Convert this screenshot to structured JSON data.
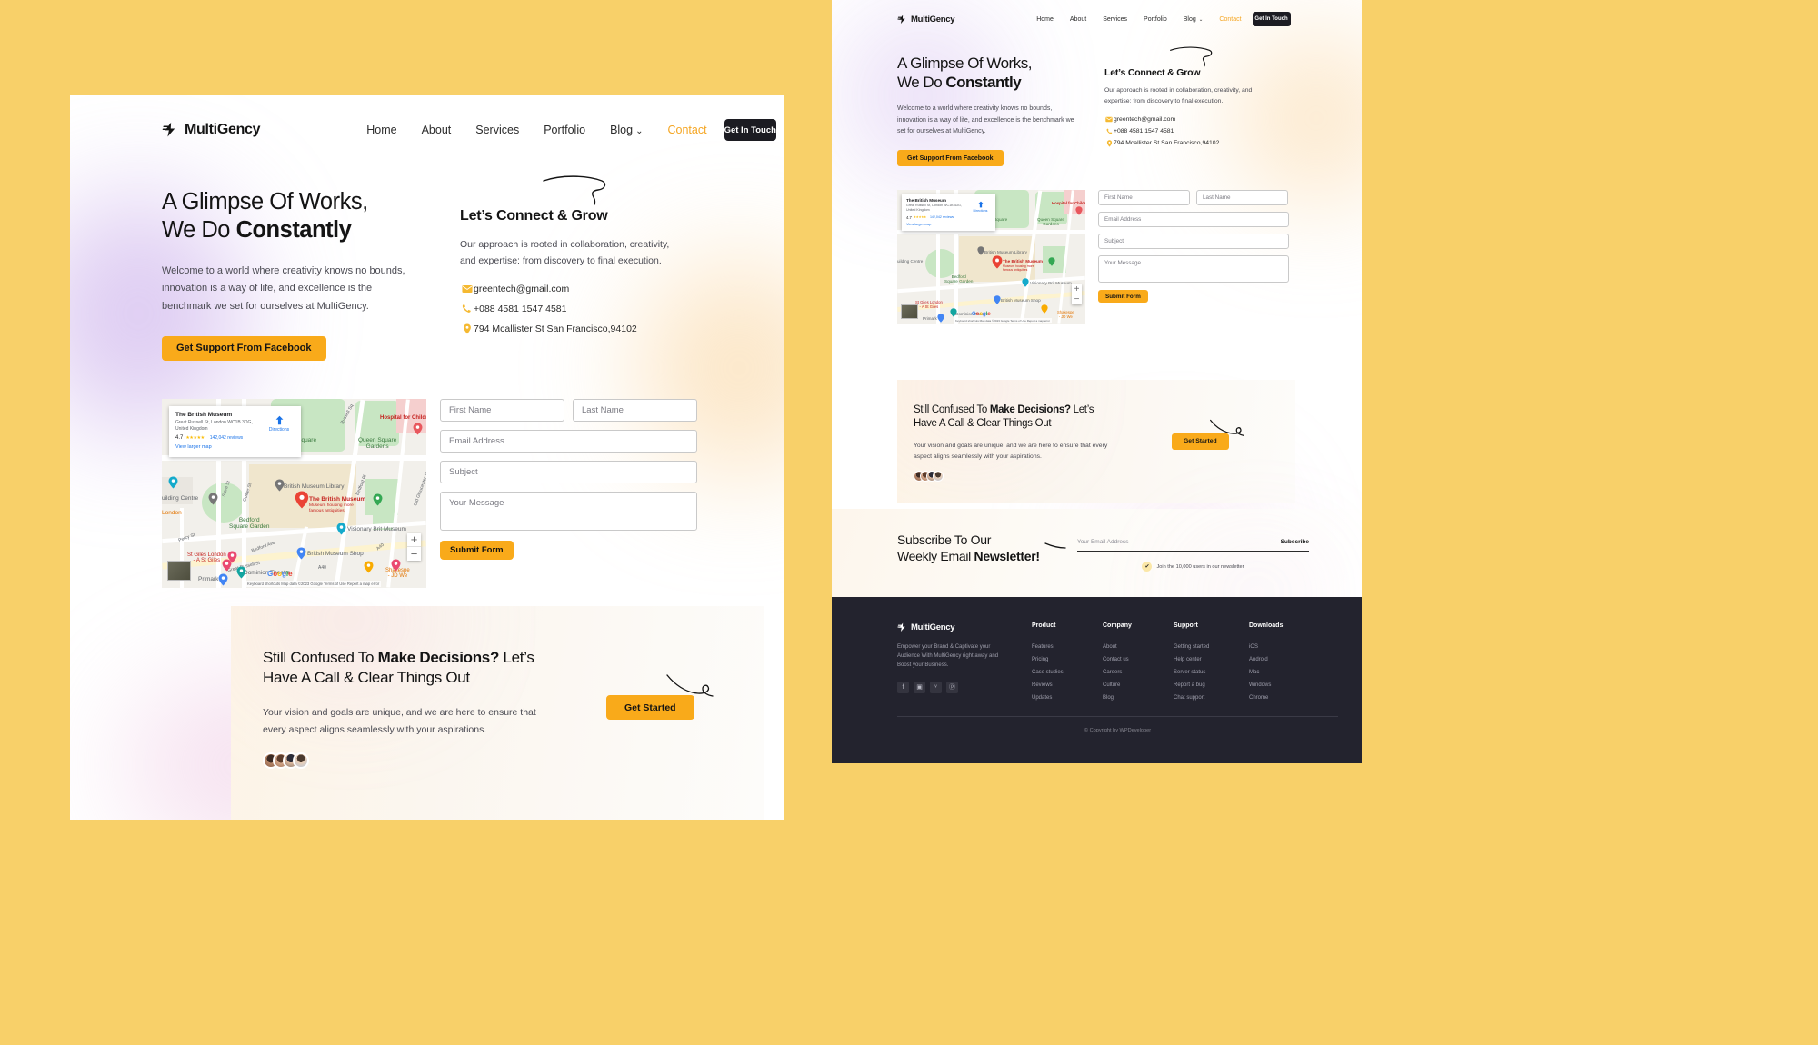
{
  "theme": {
    "bg_yellow": "#F8D069",
    "accent_yellow": "#F9AA1A",
    "nav_active": "#F5A623",
    "dark": "#1c1c22",
    "footer_bg": "#23232e"
  },
  "nav": {
    "brand": "MultiGency",
    "brand_icon": "bolt-icon",
    "links": [
      {
        "label": "Home",
        "active": false,
        "dropdown": false
      },
      {
        "label": "About",
        "active": false,
        "dropdown": false
      },
      {
        "label": "Services",
        "active": false,
        "dropdown": false
      },
      {
        "label": "Portfolio",
        "active": false,
        "dropdown": false
      },
      {
        "label": "Blog",
        "active": false,
        "dropdown": true
      },
      {
        "label": "Contact",
        "active": true,
        "dropdown": false
      }
    ],
    "cta": "Get In Touch",
    "chevron": "⌄"
  },
  "hero": {
    "title_line1": "A Glimpse Of Works,",
    "title_line2_normal": "We Do ",
    "title_line2_bold": "Constantly",
    "paragraph": "Welcome to a world where creativity knows no bounds, innovation is a way of life, and excellence is the benchmark we set for ourselves at MultiGency.",
    "cta": "Get Support From Facebook"
  },
  "connect": {
    "title": "Let’s Connect & Grow",
    "paragraph": "Our approach is rooted in collaboration, creativity, and expertise: from discovery to final execution.",
    "items": [
      {
        "icon": "mail-icon",
        "text": "greentech@gmail.com"
      },
      {
        "icon": "phone-icon",
        "text": "+088 4581 1547 4581"
      },
      {
        "icon": "location-pin-icon",
        "text": "794 Mcallister St San Francisco,94102"
      }
    ]
  },
  "map": {
    "info_card": {
      "title": "The British Museum",
      "address_line1": "Great Russell St, London WC1B 3DG,",
      "address_line2": "United Kingdom",
      "rating": "4.7",
      "stars": "★★★★★",
      "reviews": "142,042 reviews",
      "view_larger": "View larger map",
      "directions": "Directions",
      "directions_icon": "directions-arrow-icon"
    },
    "labels": [
      {
        "text": "Russell Square",
        "color": "green"
      },
      {
        "text": "Queen Square",
        "color": "green"
      },
      {
        "text": "Gardens",
        "color": "green"
      },
      {
        "text": "Hospital for Children",
        "color": "red"
      },
      {
        "text": "British Museum Library",
        "color": "grey"
      },
      {
        "text": "The British Museum",
        "color": "red"
      },
      {
        "text": "Museum housing more",
        "color": "red"
      },
      {
        "text": "famous antiquities",
        "color": "red"
      },
      {
        "text": "Visionary Brit Museum",
        "color": "grey"
      },
      {
        "text": "British Museum Shop",
        "color": "grey"
      },
      {
        "text": "Bedford",
        "color": "green"
      },
      {
        "text": "Square Garden",
        "color": "green"
      },
      {
        "text": "St Giles London",
        "color": "red"
      },
      {
        "text": "- A St Giles",
        "color": "red"
      },
      {
        "text": "Dominion Theatre",
        "color": "grey"
      },
      {
        "text": "Primark",
        "color": "grey"
      },
      {
        "text": "Shakespe",
        "color": "orange"
      },
      {
        "text": "- JD We",
        "color": "orange"
      },
      {
        "text": "Building Centre",
        "color": "grey"
      },
      {
        "text": "London",
        "color": "orange"
      }
    ],
    "streets": [
      "Store St",
      "Gower St",
      "Percy St",
      "Morwell St",
      "Bedford Ave",
      "Great Russell St",
      "Bedford Pl",
      "Old Gloucester St",
      "Russell Sq",
      "A40",
      "Chen"
    ],
    "google_logo": "Google",
    "zoom_in": "+",
    "zoom_out": "−",
    "attribution": "Keyboard shortcuts     Map data ©2023 Google     Terms of Use     Report a map error"
  },
  "form": {
    "first_name": "First Name",
    "last_name": "Last Name",
    "email": "Email Address",
    "subject": "Subject",
    "message": "Your Message",
    "submit": "Submit Form"
  },
  "cta_band": {
    "title_a": "Still Confused To ",
    "title_b": "Make Decisions?",
    "title_c": " Let’s",
    "title_line2": "Have A Call & Clear Things Out",
    "paragraph": "Your vision and goals are unique, and we are here to ensure that every aspect aligns seamlessly with your aspirations.",
    "button": "Get Started",
    "avatar_count": 4
  },
  "newsletter": {
    "title_line1": "Subscribe To Our",
    "title_line2_normal": "Weekly Email ",
    "title_line2_bold": "Newsletter!",
    "placeholder": "Your Email Address",
    "subscribe": "Subscribe",
    "note": "Join the 10,000 users in our newsletter",
    "check_icon": "check-icon"
  },
  "footer": {
    "brand": "MultiGency",
    "description": "Empower your Brand & Captivate your Audience With MultiGency right away and Boost your Business.",
    "socials": [
      {
        "icon": "facebook-icon",
        "glyph": "f"
      },
      {
        "icon": "instagram-icon",
        "glyph": "▣"
      },
      {
        "icon": "twitter-icon",
        "glyph": "ᵛ"
      },
      {
        "icon": "pinterest-icon",
        "glyph": "ⓟ"
      }
    ],
    "columns": [
      {
        "heading": "Product",
        "links": [
          "Features",
          "Pricing",
          "Case studies",
          "Reviews",
          "Updates"
        ]
      },
      {
        "heading": "Company",
        "links": [
          "About",
          "Contact us",
          "Careers",
          "Culture",
          "Blog"
        ]
      },
      {
        "heading": "Support",
        "links": [
          "Getting started",
          "Help center",
          "Server status",
          "Report a bug",
          "Chat support"
        ]
      },
      {
        "heading": "Downloads",
        "links": [
          "iOS",
          "Android",
          "Mac",
          "Windows",
          "Chrome"
        ]
      }
    ],
    "copyright": "© Copyright by WPDeveloper"
  }
}
